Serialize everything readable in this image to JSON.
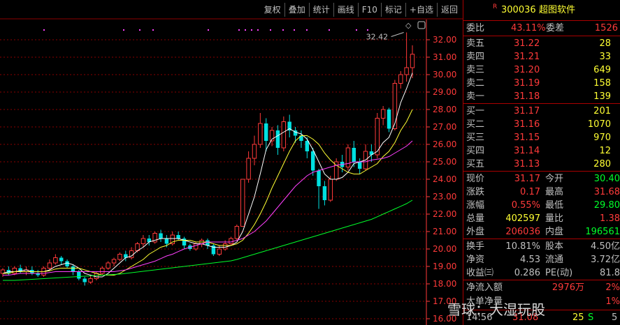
{
  "toolbar": [
    "复权",
    "叠加",
    "统计",
    "画线",
    "F10",
    "标记",
    "+自选",
    "返回"
  ],
  "chart": {
    "price_ticks": [
      "32.00",
      "31.00",
      "30.00",
      "29.00",
      "28.00",
      "27.00",
      "26.00",
      "25.00",
      "24.00",
      "23.00",
      "22.00",
      "21.00",
      "20.00",
      "19.00",
      "18.00",
      "17.00",
      "16.00"
    ],
    "high_label": "32.42",
    "colors": {
      "up": "#ff3a3a",
      "down": "#00e0e0",
      "ma5": "#ffffff",
      "ma10": "#ffff33",
      "ma20": "#ff40ff",
      "ma60": "#00ff2a",
      "grid": "#8b0000",
      "axis": "#ff3a3a"
    }
  },
  "chart_data": {
    "type": "candlestick",
    "ylim": [
      16,
      33
    ],
    "y_ticks": [
      32,
      31,
      30,
      29,
      28,
      27,
      26,
      25,
      24,
      23,
      22,
      21,
      20,
      19,
      18,
      17,
      16
    ],
    "annotations": [
      "32.42"
    ],
    "candles": [
      [
        18.6,
        18.8,
        18.4,
        18.9
      ],
      [
        18.8,
        18.6,
        18.5,
        19.0
      ],
      [
        18.6,
        18.9,
        18.5,
        19.0
      ],
      [
        18.9,
        18.7,
        18.6,
        19.1
      ],
      [
        18.7,
        18.8,
        18.5,
        19.0
      ],
      [
        18.8,
        18.6,
        18.5,
        19.0
      ],
      [
        18.6,
        18.5,
        18.4,
        18.8
      ],
      [
        18.5,
        18.9,
        18.4,
        19.0
      ],
      [
        18.9,
        19.2,
        18.8,
        19.4
      ],
      [
        19.2,
        19.5,
        19.1,
        19.7
      ],
      [
        19.5,
        19.3,
        19.1,
        19.6
      ],
      [
        19.3,
        19.0,
        18.9,
        19.4
      ],
      [
        19.0,
        18.7,
        18.5,
        19.1
      ],
      [
        18.7,
        18.3,
        18.2,
        18.8
      ],
      [
        18.3,
        18.1,
        17.9,
        18.4
      ],
      [
        18.1,
        18.3,
        18.0,
        18.5
      ],
      [
        18.3,
        18.6,
        18.2,
        18.7
      ],
      [
        18.6,
        18.9,
        18.5,
        19.0
      ],
      [
        18.9,
        19.2,
        18.8,
        19.3
      ],
      [
        19.2,
        19.4,
        19.0,
        19.5
      ],
      [
        19.4,
        19.7,
        19.3,
        19.8
      ],
      [
        19.7,
        19.5,
        19.3,
        19.9
      ],
      [
        19.5,
        19.9,
        19.4,
        20.1
      ],
      [
        19.9,
        20.3,
        19.8,
        20.4
      ],
      [
        20.3,
        20.6,
        20.1,
        20.8
      ],
      [
        20.6,
        20.4,
        20.2,
        20.8
      ],
      [
        20.4,
        20.9,
        20.3,
        21.0
      ],
      [
        20.9,
        20.6,
        20.4,
        21.1
      ],
      [
        20.6,
        20.3,
        20.1,
        20.8
      ],
      [
        20.3,
        20.8,
        20.2,
        21.0
      ],
      [
        20.8,
        20.6,
        20.5,
        21.0
      ],
      [
        20.6,
        20.2,
        20.0,
        20.7
      ],
      [
        20.2,
        20.0,
        19.9,
        20.3
      ],
      [
        20.0,
        20.3,
        19.9,
        20.4
      ],
      [
        20.3,
        20.5,
        20.1,
        20.6
      ],
      [
        20.5,
        20.2,
        20.0,
        20.6
      ],
      [
        20.2,
        19.7,
        19.6,
        20.3
      ],
      [
        19.7,
        20.0,
        19.6,
        20.2
      ],
      [
        20.0,
        20.3,
        19.9,
        20.5
      ],
      [
        20.3,
        20.6,
        20.2,
        20.7
      ],
      [
        20.6,
        21.3,
        20.5,
        21.4
      ],
      [
        21.3,
        24.0,
        21.3,
        24.0
      ],
      [
        24.0,
        25.2,
        23.8,
        25.6
      ],
      [
        25.2,
        26.0,
        24.8,
        26.5
      ],
      [
        26.0,
        27.2,
        25.8,
        27.8
      ],
      [
        27.2,
        26.2,
        25.6,
        27.5
      ],
      [
        26.2,
        26.8,
        25.9,
        27.0
      ],
      [
        26.8,
        25.8,
        25.4,
        27.1
      ],
      [
        25.8,
        27.3,
        25.6,
        27.6
      ],
      [
        27.3,
        26.8,
        26.4,
        27.7
      ],
      [
        26.8,
        26.5,
        26.1,
        27.0
      ],
      [
        26.5,
        26.2,
        25.8,
        26.8
      ],
      [
        26.2,
        25.6,
        25.2,
        26.4
      ],
      [
        25.6,
        24.5,
        24.2,
        25.8
      ],
      [
        24.5,
        23.6,
        22.3,
        24.6
      ],
      [
        23.6,
        22.8,
        22.5,
        23.9
      ],
      [
        22.8,
        24.0,
        22.7,
        24.2
      ],
      [
        24.0,
        25.0,
        23.9,
        25.2
      ],
      [
        25.0,
        24.7,
        24.4,
        25.4
      ],
      [
        24.7,
        25.8,
        24.5,
        26.0
      ],
      [
        25.8,
        25.0,
        24.7,
        26.2
      ],
      [
        25.0,
        24.6,
        24.3,
        25.2
      ],
      [
        24.6,
        25.6,
        24.5,
        26.0
      ],
      [
        25.6,
        25.4,
        25.0,
        26.0
      ],
      [
        25.4,
        27.5,
        25.2,
        27.8
      ],
      [
        27.5,
        28.0,
        27.1,
        28.2
      ],
      [
        28.0,
        26.9,
        26.7,
        28.1
      ],
      [
        26.9,
        29.5,
        26.8,
        29.7
      ],
      [
        29.5,
        30.0,
        29.2,
        30.2
      ],
      [
        30.0,
        30.4,
        29.6,
        32.42
      ],
      [
        30.4,
        31.17,
        29.8,
        31.68
      ]
    ],
    "ma_lines": [
      {
        "name": "MA5",
        "color": "#ffffff",
        "values": [
          18.6,
          18.7,
          18.7,
          18.75,
          18.8,
          18.7,
          18.7,
          18.7,
          18.8,
          19.0,
          19.1,
          19.2,
          19.1,
          18.9,
          18.6,
          18.5,
          18.4,
          18.4,
          18.6,
          18.9,
          19.2,
          19.5,
          19.6,
          19.9,
          20.1,
          20.4,
          20.5,
          20.6,
          20.6,
          20.6,
          20.6,
          20.5,
          20.4,
          20.3,
          20.3,
          20.2,
          20.1,
          20.1,
          20.1,
          20.2,
          20.4,
          21.0,
          22.0,
          23.0,
          24.3,
          25.7,
          26.3,
          26.5,
          26.7,
          26.9,
          26.7,
          26.6,
          26.3,
          25.7,
          25.0,
          24.3,
          24.0,
          24.0,
          24.1,
          24.4,
          24.9,
          25.0,
          25.1,
          25.4,
          25.6,
          26.1,
          26.4,
          27.2,
          28.4,
          29.2,
          30.1
        ]
      },
      {
        "name": "MA10",
        "color": "#ffff33",
        "values": [
          18.6,
          18.6,
          18.7,
          18.7,
          18.7,
          18.7,
          18.7,
          18.7,
          18.75,
          18.85,
          18.9,
          18.9,
          18.9,
          18.9,
          18.8,
          18.7,
          18.6,
          18.5,
          18.5,
          18.5,
          18.6,
          18.8,
          19.0,
          19.2,
          19.4,
          19.7,
          19.9,
          20.1,
          20.2,
          20.4,
          20.5,
          20.5,
          20.5,
          20.4,
          20.4,
          20.4,
          20.3,
          20.2,
          20.2,
          20.2,
          20.3,
          20.5,
          20.9,
          21.4,
          22.0,
          22.7,
          23.5,
          24.2,
          24.9,
          25.6,
          26.2,
          26.5,
          26.5,
          26.3,
          26.0,
          25.5,
          25.1,
          24.8,
          24.6,
          24.4,
          24.3,
          24.3,
          24.5,
          24.7,
          24.9,
          25.3,
          25.6,
          26.1,
          26.8,
          27.3,
          28.0
        ]
      },
      {
        "name": "MA20",
        "color": "#ff40ff",
        "values": [
          18.5,
          18.5,
          18.55,
          18.6,
          18.6,
          18.6,
          18.6,
          18.6,
          18.65,
          18.7,
          18.7,
          18.7,
          18.7,
          18.7,
          18.7,
          18.7,
          18.7,
          18.7,
          18.7,
          18.7,
          18.75,
          18.8,
          18.9,
          19.0,
          19.1,
          19.2,
          19.3,
          19.45,
          19.6,
          19.7,
          19.85,
          20.0,
          20.1,
          20.2,
          20.3,
          20.4,
          20.4,
          20.4,
          20.4,
          20.4,
          20.5,
          20.6,
          20.8,
          21.0,
          21.3,
          21.6,
          22.0,
          22.4,
          22.8,
          23.2,
          23.6,
          23.9,
          24.2,
          24.4,
          24.5,
          24.6,
          24.7,
          24.8,
          24.85,
          24.9,
          25.0,
          25.0,
          25.0,
          25.1,
          25.15,
          25.2,
          25.3,
          25.5,
          25.7,
          25.9,
          26.2
        ]
      },
      {
        "name": "MA60",
        "color": "#00ff2a",
        "values": [
          18.2,
          18.2,
          18.2,
          18.22,
          18.24,
          18.26,
          18.28,
          18.3,
          18.32,
          18.34,
          18.36,
          18.38,
          18.4,
          18.42,
          18.44,
          18.46,
          18.48,
          18.5,
          18.52,
          18.54,
          18.56,
          18.6,
          18.64,
          18.68,
          18.72,
          18.76,
          18.8,
          18.84,
          18.88,
          18.92,
          18.96,
          19.0,
          19.04,
          19.08,
          19.12,
          19.16,
          19.2,
          19.24,
          19.28,
          19.32,
          19.4,
          19.5,
          19.6,
          19.7,
          19.8,
          19.9,
          20.0,
          20.1,
          20.2,
          20.3,
          20.4,
          20.5,
          20.6,
          20.7,
          20.8,
          20.9,
          21.0,
          21.1,
          21.2,
          21.3,
          21.4,
          21.5,
          21.6,
          21.7,
          21.85,
          22.0,
          22.15,
          22.3,
          22.45,
          22.6,
          22.8
        ]
      }
    ]
  },
  "stock": {
    "marker": "R",
    "code": "300036",
    "name": "超图软件"
  },
  "weibi": {
    "label": "委比",
    "value": "43.11%",
    "diff_label": "委差",
    "diff": "1526"
  },
  "asks": [
    {
      "label": "卖五",
      "price": "31.22",
      "vol": "28"
    },
    {
      "label": "卖四",
      "price": "31.21",
      "vol": "33"
    },
    {
      "label": "卖三",
      "price": "31.20",
      "vol": "649"
    },
    {
      "label": "卖二",
      "price": "31.19",
      "vol": "158"
    },
    {
      "label": "卖一",
      "price": "31.18",
      "vol": "139"
    }
  ],
  "bids": [
    {
      "label": "买一",
      "price": "31.17",
      "vol": "201"
    },
    {
      "label": "买二",
      "price": "31.16",
      "vol": "1070"
    },
    {
      "label": "买三",
      "price": "31.15",
      "vol": "970"
    },
    {
      "label": "买四",
      "price": "31.14",
      "vol": "12"
    },
    {
      "label": "买五",
      "price": "31.13",
      "vol": "280"
    }
  ],
  "quote": [
    {
      "l1": "现价",
      "v1": "31.17",
      "c1": "red",
      "l2": "今开",
      "v2": "30.40",
      "c2": "green"
    },
    {
      "l1": "涨跌",
      "v1": "0.17",
      "c1": "red",
      "l2": "最高",
      "v2": "31.68",
      "c2": "red"
    },
    {
      "l1": "涨幅",
      "v1": "0.55%",
      "c1": "red",
      "l2": "最低",
      "v2": "29.80",
      "c2": "green"
    },
    {
      "l1": "总量",
      "v1": "402597",
      "c1": "yellow",
      "l2": "量比",
      "v2": "1.38",
      "c2": "red"
    },
    {
      "l1": "外盘",
      "v1": "206036",
      "c1": "red",
      "l2": "内盘",
      "v2": "196561",
      "c2": "green"
    }
  ],
  "stats": [
    {
      "l1": "换手",
      "v1": "10.81%",
      "l2": "股本",
      "v2": "4.50亿"
    },
    {
      "l1": "净资",
      "v1": "4.53",
      "l2": "流通",
      "v2": "3.72亿"
    },
    {
      "l1": "收益㈢",
      "v1": "0.286",
      "l2": "PE(动)",
      "v2": "81.8"
    }
  ],
  "flow": [
    {
      "label": "净流入额",
      "value": "2976万",
      "pct": "2%"
    },
    {
      "label": "大单净量",
      "value": "",
      "pct": "1%"
    }
  ],
  "tick": {
    "time": "14:56",
    "price": "31.08",
    "vol": "25",
    "side": "S",
    "extra": "5"
  },
  "watermark": "雪球：大湿玩股"
}
